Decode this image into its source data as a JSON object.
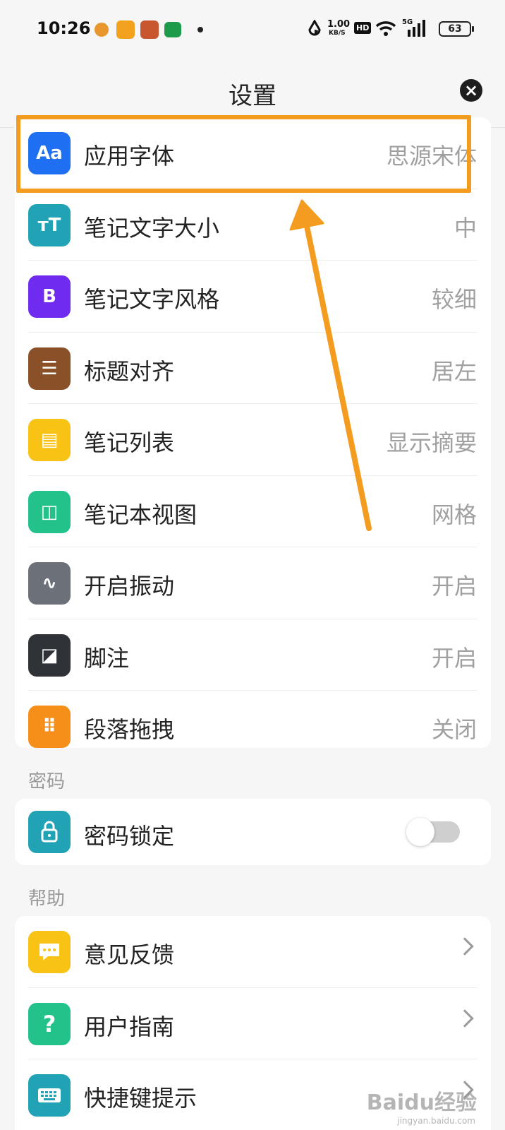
{
  "status_bar": {
    "time": "10:26",
    "net_speed_value": "1.00",
    "net_speed_unit": "KB/S",
    "hd_label": "HD",
    "network": "5G",
    "battery": "63"
  },
  "header": {
    "title": "设置"
  },
  "settings_group": {
    "items": [
      {
        "label": "应用字体",
        "value": "思源宋体",
        "icon": "font-icon",
        "icon_text": "Aa",
        "color": "#1e6ff2"
      },
      {
        "label": "笔记文字大小",
        "value": "中",
        "icon": "text-size-icon",
        "icon_text": "тT",
        "color": "#22a3b5"
      },
      {
        "label": "笔记文字风格",
        "value": "较细",
        "icon": "bold-icon",
        "icon_text": "B",
        "color": "#6f2cf0"
      },
      {
        "label": "标题对齐",
        "value": "居左",
        "icon": "align-icon",
        "icon_text": "☰",
        "color": "#8a5128"
      },
      {
        "label": "笔记列表",
        "value": "显示摘要",
        "icon": "document-icon",
        "icon_text": "▤",
        "color": "#f8c314"
      },
      {
        "label": "笔记本视图",
        "value": "网格",
        "icon": "grid-view-icon",
        "icon_text": "◫",
        "color": "#23c28a"
      },
      {
        "label": "开启振动",
        "value": "开启",
        "icon": "vibration-icon",
        "icon_text": "∿",
        "color": "#6c7078"
      },
      {
        "label": "脚注",
        "value": "开启",
        "icon": "footnote-icon",
        "icon_text": "◪",
        "color": "#2f3237"
      },
      {
        "label": "段落拖拽",
        "value": "关闭",
        "icon": "drag-handle-icon",
        "icon_text": "⠿",
        "color": "#f58f1a"
      }
    ]
  },
  "password_section": {
    "heading": "密码",
    "item": {
      "label": "密码锁定",
      "icon": "lock-icon",
      "icon_text": "🔒",
      "color": "#22a3b5",
      "enabled": false
    }
  },
  "help_section": {
    "heading": "帮助",
    "items": [
      {
        "label": "意见反馈",
        "icon": "feedback-icon",
        "icon_text": "…",
        "color": "#f8c314"
      },
      {
        "label": "用户指南",
        "icon": "question-icon",
        "icon_text": "?",
        "color": "#23c28a"
      },
      {
        "label": "快捷键提示",
        "icon": "keyboard-icon",
        "icon_text": "⌨",
        "color": "#22a3b5"
      }
    ]
  },
  "annotation": {
    "color": "#f39c1f"
  },
  "watermark": {
    "text": "Baidu经验",
    "sub": "jingyan.baidu.com"
  }
}
